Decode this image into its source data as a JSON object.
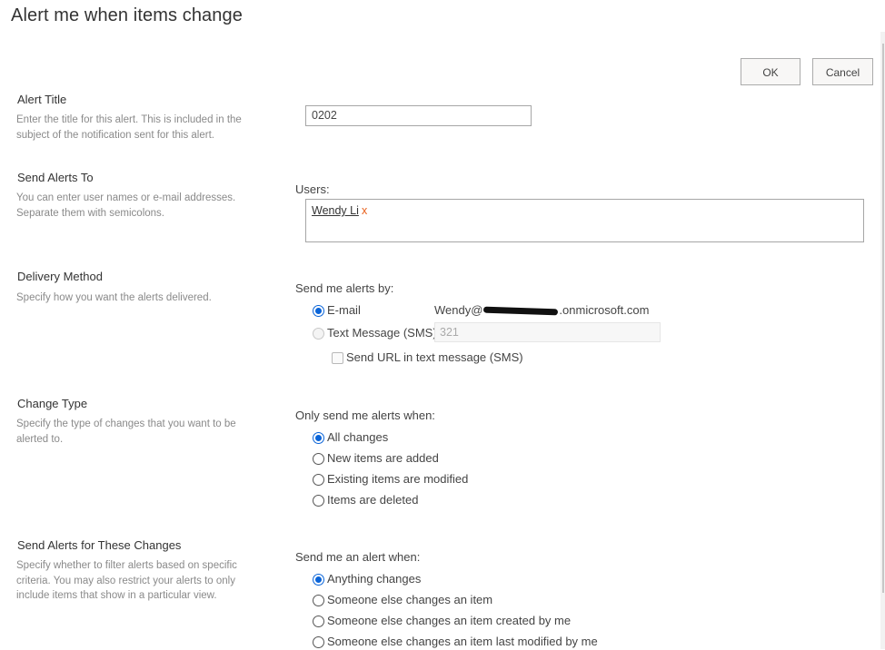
{
  "page": {
    "title": "Alert me when items change"
  },
  "actions": {
    "ok_label": "OK",
    "cancel_label": "Cancel"
  },
  "sections": {
    "alert_title": {
      "title": "Alert Title",
      "description": "Enter the title for this alert. This is included in the subject of the notification sent for this alert.",
      "input_value": "0202"
    },
    "send_to": {
      "title": "Send Alerts To",
      "description": "You can enter user names or e-mail addresses. Separate them with semicolons.",
      "users_label": "Users:",
      "users": [
        {
          "name": "Wendy Li",
          "remove_glyph": "x"
        }
      ]
    },
    "delivery": {
      "title": "Delivery Method",
      "description": "Specify how you want the alerts delivered.",
      "prompt": "Send me alerts by:",
      "email_label": "E-mail",
      "email_checked": true,
      "email_value_prefix": "Wendy@",
      "email_value_suffix": ".onmicrosoft.com",
      "sms_label": "Text Message (SMS)",
      "sms_checked": false,
      "sms_disabled": true,
      "sms_value": "321",
      "send_url_label": "Send URL in text message (SMS)",
      "send_url_checked": false
    },
    "change_type": {
      "title": "Change Type",
      "description": "Specify the type of changes that you want to be alerted to.",
      "prompt": "Only send me alerts when:",
      "options": [
        {
          "label": "All changes",
          "checked": true
        },
        {
          "label": "New items are added",
          "checked": false
        },
        {
          "label": "Existing items are modified",
          "checked": false
        },
        {
          "label": "Items are deleted",
          "checked": false
        }
      ]
    },
    "filter": {
      "title": "Send Alerts for These Changes",
      "description": "Specify whether to filter alerts based on specific criteria. You may also restrict your alerts to only include items that show in a particular view.",
      "prompt": "Send me an alert when:",
      "options": [
        {
          "label": "Anything changes",
          "checked": true
        },
        {
          "label": "Someone else changes an item",
          "checked": false
        },
        {
          "label": "Someone else changes an item created by me",
          "checked": false
        },
        {
          "label": "Someone else changes an item last modified by me",
          "checked": false
        }
      ]
    }
  },
  "colors": {
    "accent": "#0a64d8",
    "remove_x": "#e8601c",
    "description_text": "#8a8a8a"
  }
}
